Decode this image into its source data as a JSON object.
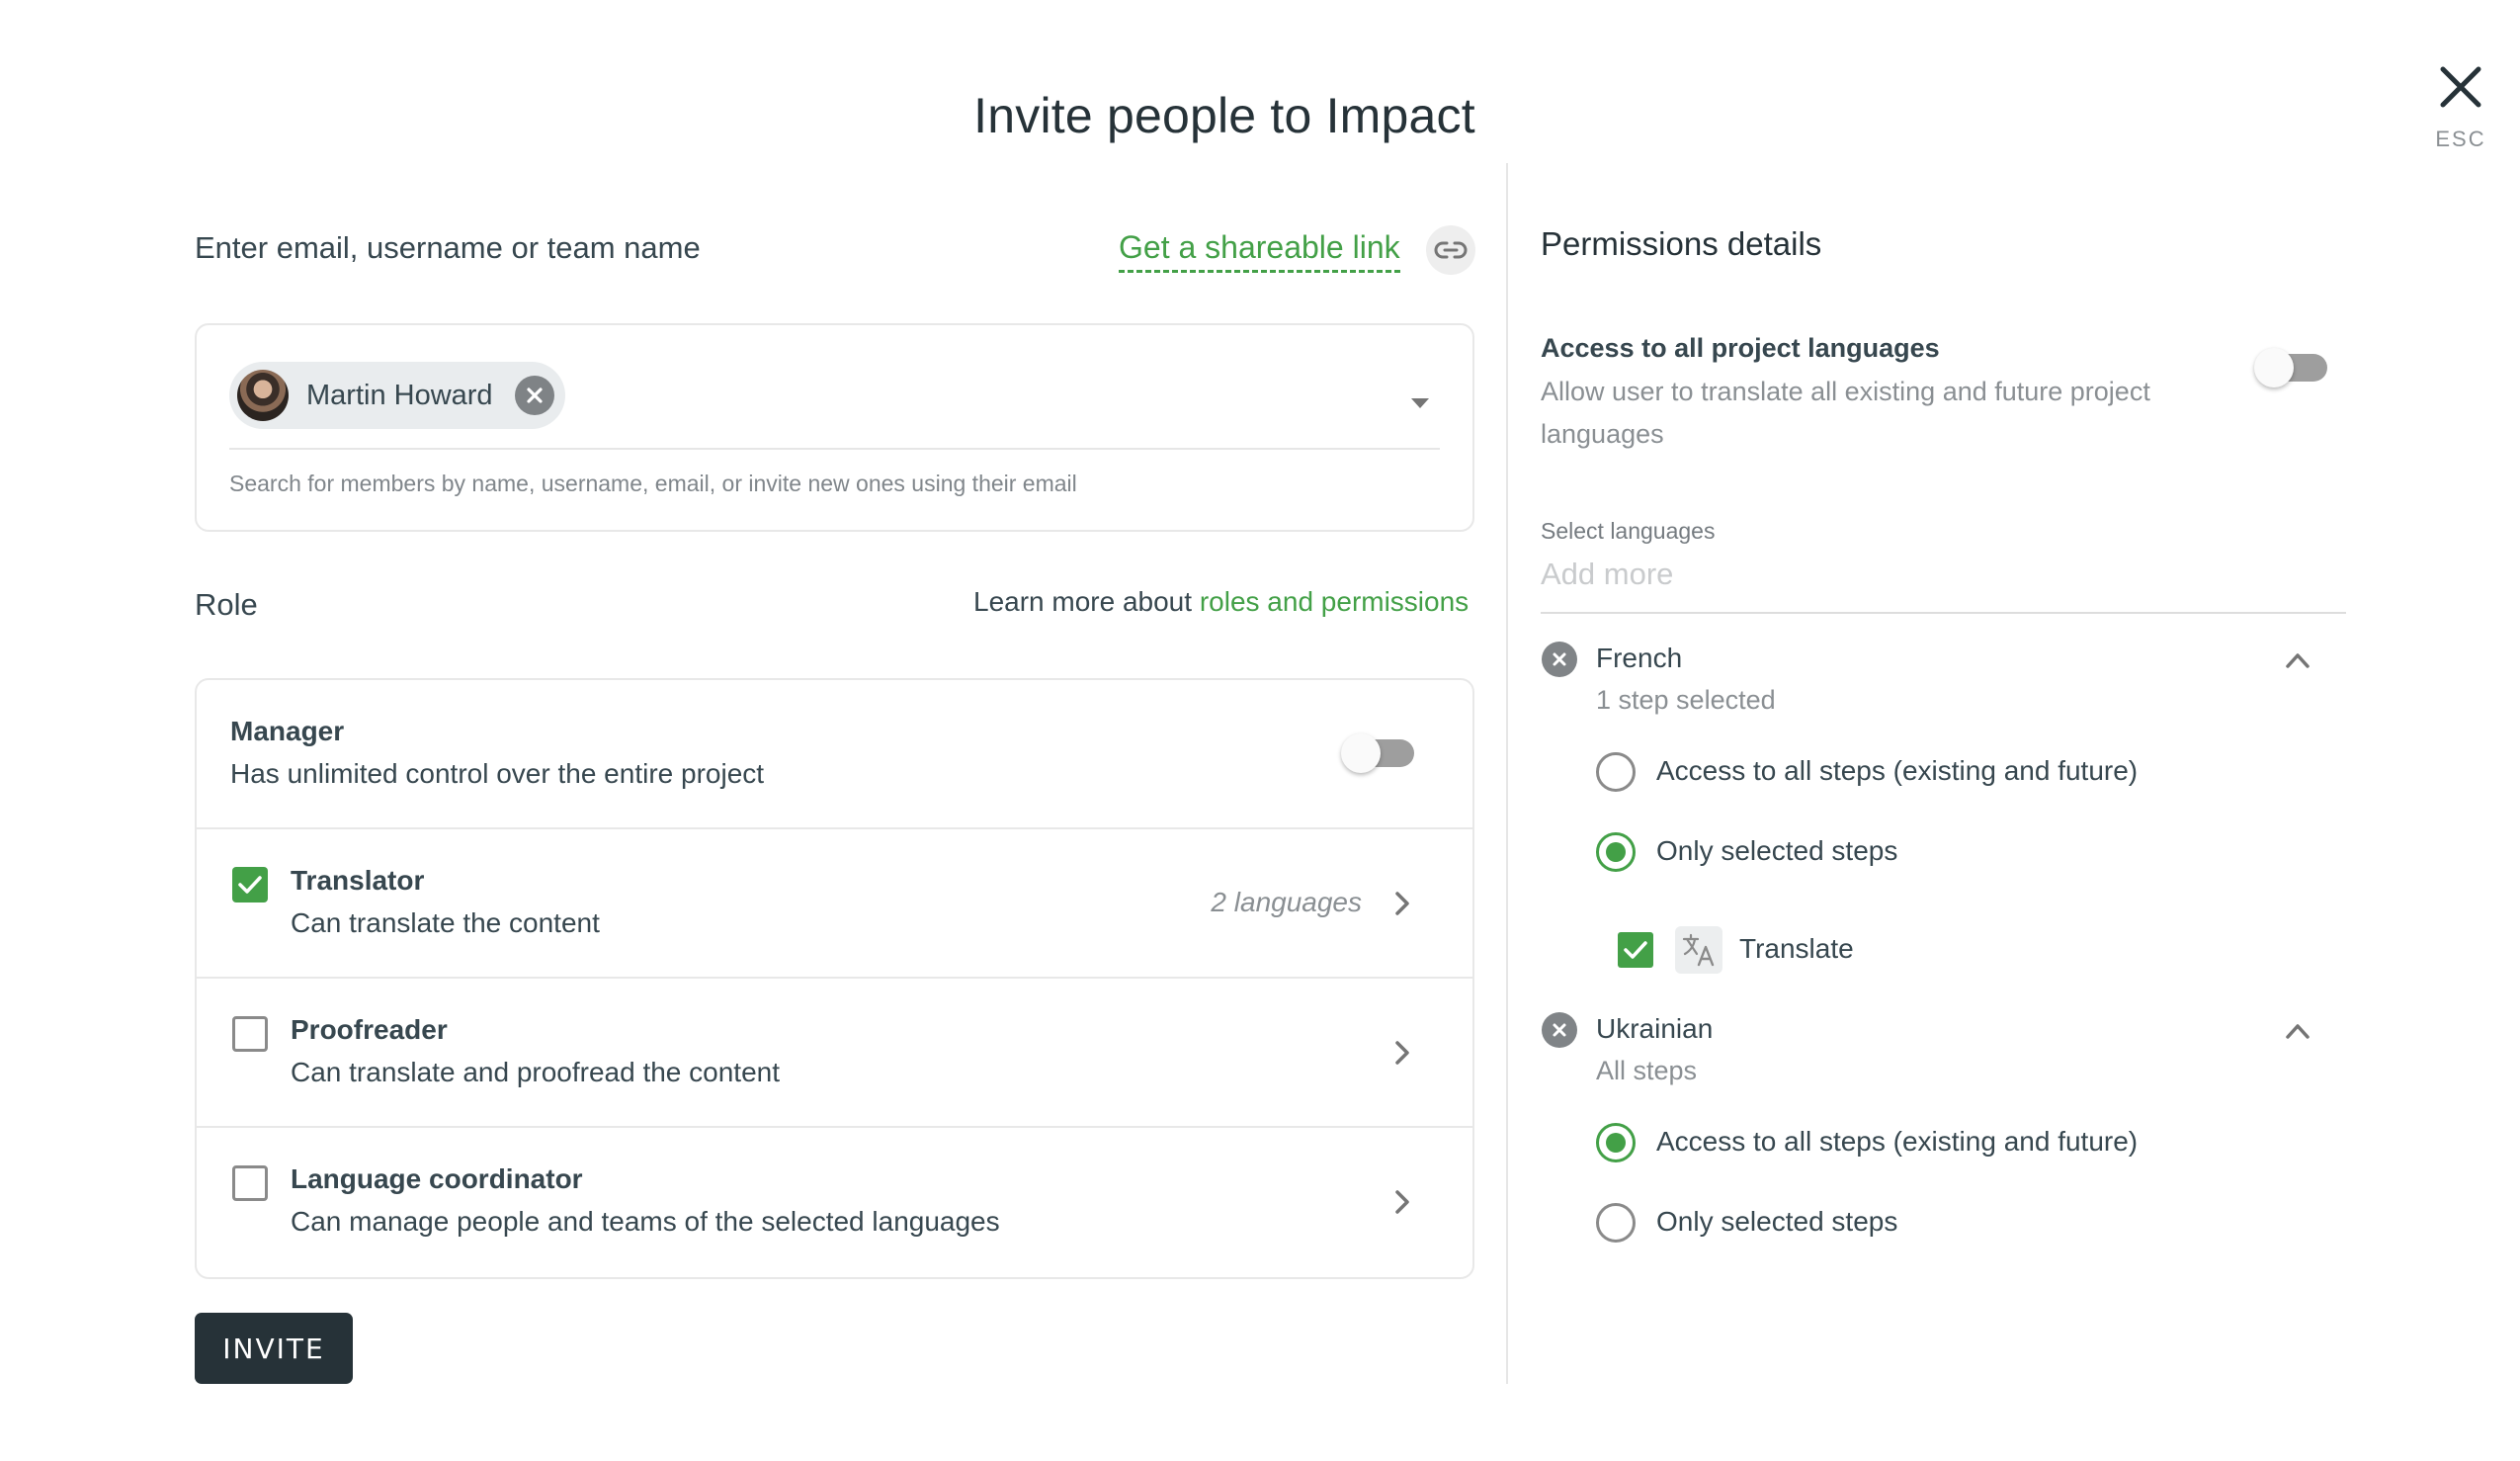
{
  "dialog": {
    "title": "Invite people to Impact",
    "close_hint": "ESC"
  },
  "invite": {
    "input_label": "Enter email, username or team name",
    "share_link": "Get a shareable link",
    "selected_members": [
      {
        "name": "Martin Howard"
      }
    ],
    "helper_text": "Search for members by name, username, email, or invite new ones using their email",
    "submit_label": "INVITE"
  },
  "role": {
    "label": "Role",
    "learn_more_prefix": "Learn more about",
    "learn_more_link": "roles and permissions",
    "items": [
      {
        "title": "Manager",
        "description": "Has unlimited control over the entire project",
        "control": "toggle",
        "enabled": false
      },
      {
        "title": "Translator",
        "description": "Can translate the content",
        "checked": true,
        "meta": "2 languages"
      },
      {
        "title": "Proofreader",
        "description": "Can translate and proofread the content",
        "checked": false
      },
      {
        "title": "Language coordinator",
        "description": "Can manage people and teams of the selected languages",
        "checked": false
      }
    ]
  },
  "permissions": {
    "title": "Permissions details",
    "all_languages": {
      "title": "Access to all project languages",
      "description": "Allow user to translate all existing and future project languages",
      "enabled": false
    },
    "select_languages_label": "Select languages",
    "add_more_placeholder": "Add more",
    "languages": [
      {
        "name": "French",
        "summary": "1 step selected",
        "expanded": true,
        "options": [
          {
            "label": "Access to all steps (existing and future)",
            "selected": false
          },
          {
            "label": "Only selected steps",
            "selected": true
          }
        ],
        "steps": [
          {
            "label": "Translate",
            "checked": true,
            "icon": "translate-icon"
          }
        ]
      },
      {
        "name": "Ukrainian",
        "summary": "All steps",
        "expanded": true,
        "options": [
          {
            "label": "Access to all steps (existing and future)",
            "selected": true
          },
          {
            "label": "Only selected steps",
            "selected": false
          }
        ]
      }
    ]
  },
  "colors": {
    "accent": "#43a047",
    "primary_dark": "#263238",
    "muted_text": "#8a8f93",
    "border": "#e8e8e8"
  }
}
